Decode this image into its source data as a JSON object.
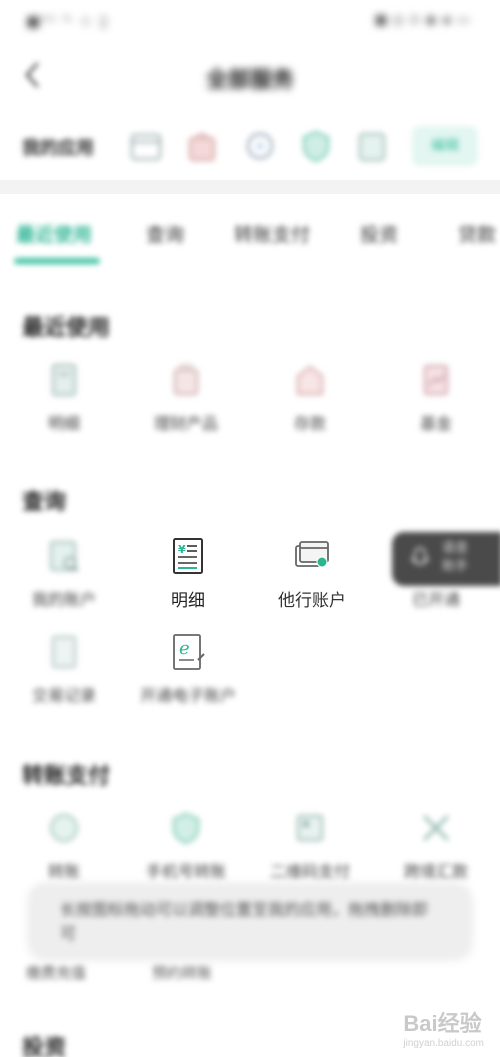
{
  "status_bar": {
    "left": "■ᴵᴸᴸ ᴵᴸ ☆ ▯",
    "right": "■ ◎ ⊙ ◉ ◈ ▭"
  },
  "header": {
    "title": "全部服务"
  },
  "quick_bar": {
    "label": "我的应用",
    "icons": [
      "calendar-icon",
      "bag-icon",
      "refresh-icon",
      "shield-icon",
      "card-icon"
    ],
    "button_label": "编辑"
  },
  "tabs": [
    {
      "label": "最近使用",
      "active": true
    },
    {
      "label": "查询",
      "active": false
    },
    {
      "label": "转账支付",
      "active": false
    },
    {
      "label": "投资",
      "active": false
    },
    {
      "label": "贷款",
      "active": false
    }
  ],
  "sections": {
    "recent": {
      "title": "最近使用",
      "items": [
        {
          "label": "明细",
          "icon": "document-icon"
        },
        {
          "label": "理财产品",
          "icon": "wealth-icon"
        },
        {
          "label": "存款",
          "icon": "deposit-icon"
        },
        {
          "label": "基金",
          "icon": "fund-icon"
        }
      ]
    },
    "query": {
      "title": "查询",
      "items": [
        {
          "label": "我的账户",
          "icon": "account-search-icon"
        },
        {
          "label": "明细",
          "icon": "receipt-icon"
        },
        {
          "label": "他行账户",
          "icon": "other-bank-card-icon"
        },
        {
          "label": "已开通",
          "icon": "activated-icon"
        },
        {
          "label": "交易记录",
          "icon": "transaction-record-icon"
        },
        {
          "label": "开通电子账户",
          "icon": "e-account-icon"
        }
      ]
    },
    "transfer": {
      "title": "转账支付",
      "items": [
        {
          "label": "转账",
          "icon": "transfer-icon"
        },
        {
          "label": "手机号转账",
          "icon": "phone-transfer-icon"
        },
        {
          "label": "二维码支付",
          "icon": "qr-pay-icon"
        },
        {
          "label": "跨境汇款",
          "icon": "cross-border-icon"
        }
      ],
      "extra_items": [
        "缴费充值",
        "预约转账"
      ]
    },
    "next": {
      "title": "投资"
    }
  },
  "float_tab": {
    "line1": "语音",
    "line2": "助手"
  },
  "toast": {
    "text": "长按图标拖动可以调整位置至我的应用，拖拽删除即可"
  },
  "watermark": {
    "brand": "Bai经验",
    "url": "jingyan.baidu.com"
  },
  "colors": {
    "accent": "#3ec2a2",
    "accent_light": "#e3f6f1",
    "text": "#333333"
  }
}
